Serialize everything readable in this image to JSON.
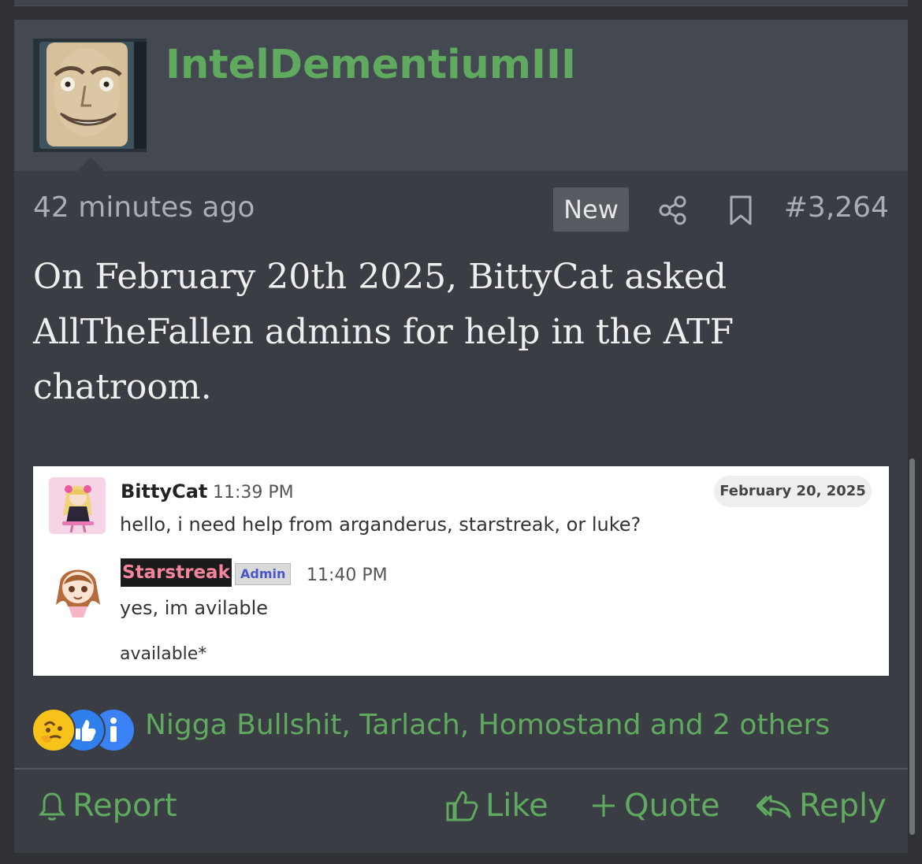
{
  "post": {
    "author": "IntelDementiumIII",
    "timestamp": "42 minutes ago",
    "new_badge": "New",
    "post_number": "#3,264",
    "body": "On February 20th 2025, BittyCat asked AllTheFallen admins for help in the ATF chatroom."
  },
  "chat": {
    "date_pill": "February 20, 2025",
    "messages": [
      {
        "author": "BittyCat",
        "time": "11:39 PM",
        "text": "hello, i need help from arganderus, starstreak, or luke?"
      },
      {
        "author": "Starstreak",
        "role": "Admin",
        "time": "11:40 PM",
        "text": "yes, im avilable",
        "followup": "available*"
      }
    ]
  },
  "reactions": {
    "icons": [
      "thinking-reaction",
      "like-reaction",
      "info-reaction"
    ],
    "names": "Nigga Bullshit, Tarlach, Homostand and 2 others"
  },
  "actions": {
    "report": "Report",
    "like": "Like",
    "quote": "Quote",
    "reply": "Reply"
  },
  "colors": {
    "accent": "#5faa5f",
    "post_bg": "#3a3d43",
    "header_bg": "#444851",
    "page_bg": "#2f3135"
  }
}
